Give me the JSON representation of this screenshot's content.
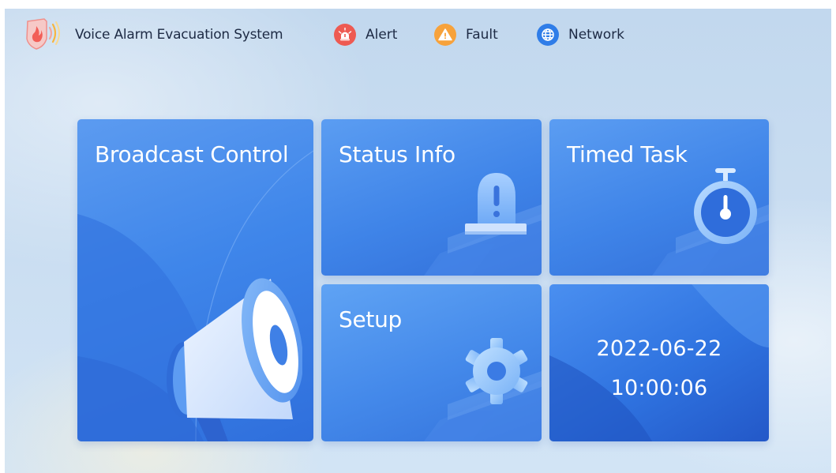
{
  "header": {
    "app_title": "Voice Alarm Evacuation System",
    "logo_icon": "shield-fire-speaker-logo",
    "status_items": [
      {
        "label": "Alert",
        "icon": "alarm-siren-icon",
        "color": "#ee5a52"
      },
      {
        "label": "Fault",
        "icon": "warning-triangle-icon",
        "color": "#f7a23b"
      },
      {
        "label": "Network",
        "icon": "globe-icon",
        "color": "#2f7de8"
      }
    ]
  },
  "tiles": {
    "broadcast": {
      "title": "Broadcast Control",
      "icon": "megaphone-icon"
    },
    "status": {
      "title": "Status Info",
      "icon": "alarm-beacon-icon"
    },
    "timed": {
      "title": "Timed Task",
      "icon": "stopwatch-icon"
    },
    "setup": {
      "title": "Setup",
      "icon": "gear-icon"
    },
    "clock": {
      "date": "2022-06-22",
      "time": "10:00:06"
    }
  },
  "colors": {
    "tile_blue": "#3f86ea",
    "background": "#c9ddf1",
    "text_dark": "#1d2a44"
  }
}
